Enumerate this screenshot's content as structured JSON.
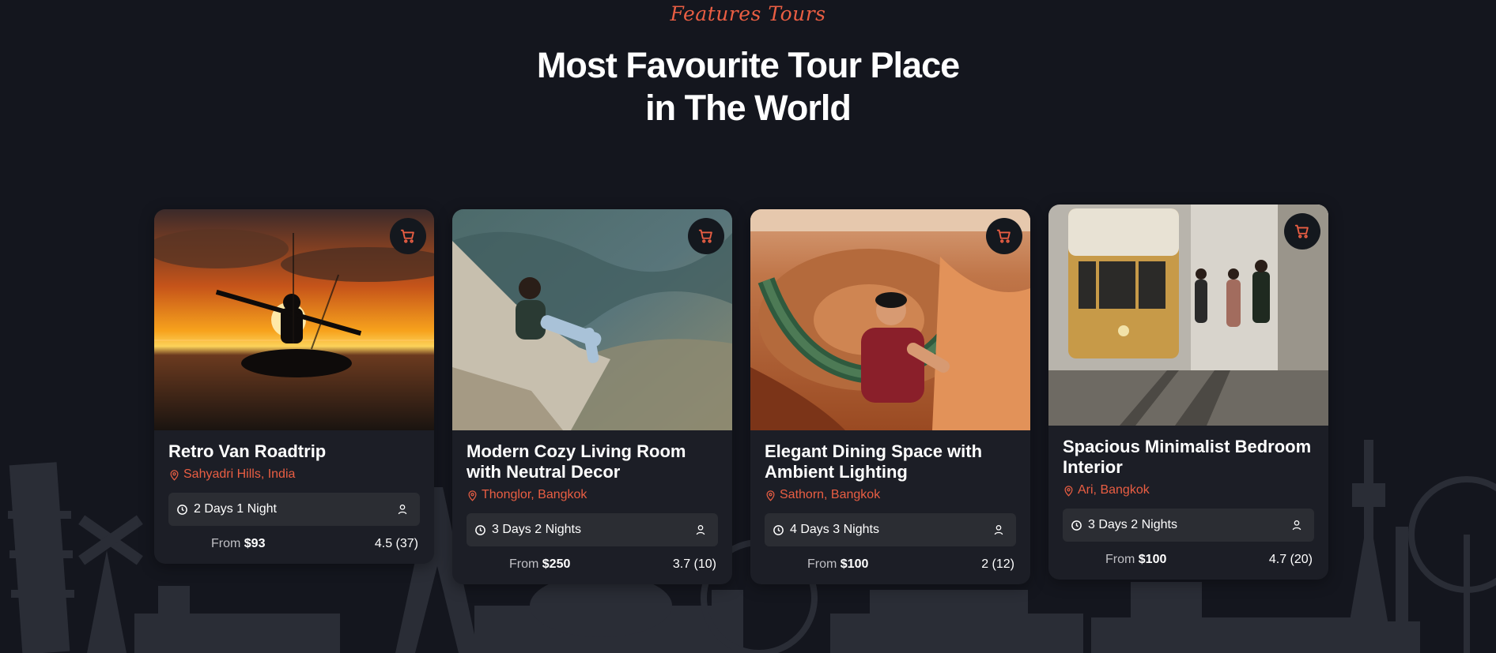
{
  "section": {
    "eyebrow": "Features Tours",
    "headline_line1": "Most Favourite Tour Place",
    "headline_line2": "in The World"
  },
  "icons": {
    "cart": "cart-icon",
    "location": "location-pin-icon",
    "clock": "clock-icon",
    "person": "person-icon"
  },
  "colors": {
    "accent": "#ea5e43",
    "background": "#14161e",
    "card": "#1c1e26",
    "meta_bar": "#2b2d33"
  },
  "price_prefix": "From",
  "tours": [
    {
      "title": "Retro Van Roadtrip",
      "location": "Sahyadri Hills, India",
      "duration": "2 Days 1 Night",
      "price": "$93",
      "rating": "4.5 (37)"
    },
    {
      "title": "Modern Cozy Living Room with Neutral Decor",
      "location": "Thonglor, Bangkok",
      "duration": "3 Days 2 Nights",
      "price": "$250",
      "rating": "3.7 (10)"
    },
    {
      "title": "Elegant Dining Space with Ambient Lighting",
      "location": "Sathorn, Bangkok",
      "duration": "4 Days 3 Nights",
      "price": "$100",
      "rating": "2 (12)"
    },
    {
      "title": "Spacious Minimalist Bedroom Interior",
      "location": "Ari, Bangkok",
      "duration": "3 Days 2 Nights",
      "price": "$100",
      "rating": "4.7 (20)"
    }
  ]
}
